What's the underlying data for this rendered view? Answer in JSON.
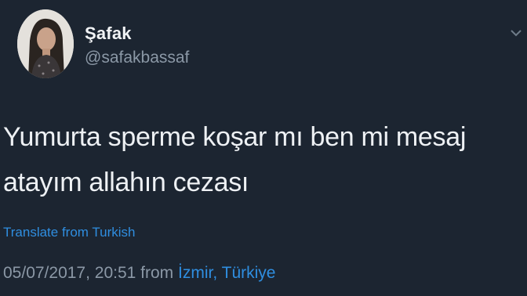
{
  "user": {
    "display_name": "Şafak",
    "handle": "@safakbassaf"
  },
  "tweet": {
    "lines": [
      "Yumurta sperme koşar mı ben mi mesaj",
      "atayım allahın cezası"
    ],
    "translate_label": "Translate from Turkish",
    "timestamp": "05/07/2017, 20:51",
    "from_label": "from",
    "location": "İzmir, Türkiye"
  },
  "icons": {
    "avatar": "profile-photo",
    "menu": "chevron-down-icon"
  },
  "colors": {
    "background": "#1c2531",
    "link": "#2f8ee0",
    "muted": "#8b98a6",
    "text": "#eef1f4"
  }
}
